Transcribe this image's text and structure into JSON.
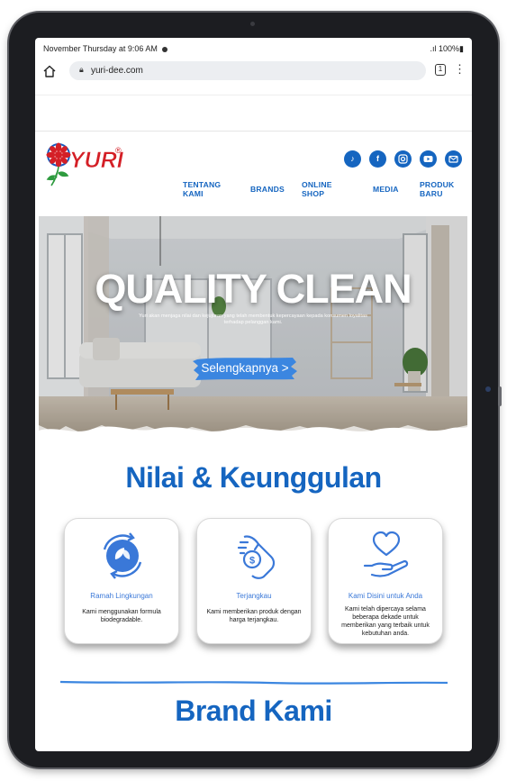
{
  "status_bar": {
    "datetime": "November Thursday at 9:06 AM",
    "battery": ".ıl 100%▮"
  },
  "browser": {
    "url": "yuri-dee.com",
    "tab_count": "1"
  },
  "header": {
    "logo_text": "YURI",
    "nav": [
      {
        "label": "TENTANG KAMI"
      },
      {
        "label": "BRANDS"
      },
      {
        "label": "ONLINE SHOP"
      },
      {
        "label": "MEDIA"
      },
      {
        "label": "PRODUK BARU"
      }
    ],
    "social_icons": [
      "tiktok-icon",
      "facebook-icon",
      "instagram-icon",
      "youtube-icon",
      "email-icon"
    ]
  },
  "hero": {
    "title": "QUALITY CLEAN",
    "subtitle": "Yuri akan menjaga nilai dan kejujuran yang telah membentuk kepercayaan kepada konsumen loyalitas terhadap pelanggan kami.",
    "cta": "Selengkapnya >"
  },
  "values_section": {
    "title": "Nilai & Keunggulan",
    "cards": [
      {
        "icon": "eco-leaf-icon",
        "title": "Ramah Lingkungan",
        "desc": "Kami menggunakan formula biodegradable."
      },
      {
        "icon": "money-hand-icon",
        "title": "Terjangkau",
        "desc": "Kami memberikan produk dengan harga terjangkau."
      },
      {
        "icon": "heart-hand-icon",
        "title": "Kami Disini untuk Anda",
        "desc": "Kami telah dipercaya selama beberapa dekade untuk memberikan yang terbaik untuk kebutuhan anda."
      }
    ]
  },
  "brand_section": {
    "title": "Brand Kami"
  },
  "colors": {
    "brand_blue": "#1565c0",
    "icon_blue": "#3a78d8",
    "logo_red": "#d41f26"
  }
}
